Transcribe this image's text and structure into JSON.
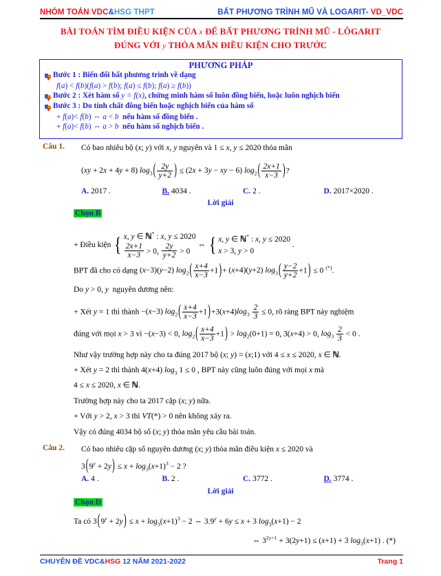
{
  "header": {
    "left_part1": "NHÓM TOÁN VDC",
    "left_amp": "&",
    "left_part2": "HSG THPT",
    "right_main": "BẤT PHƯƠNG TRÌNH MŨ VÀ LOGARIT-",
    "right_tag": "VD_VDC"
  },
  "title": {
    "line1_a": "BÀI TOÁN TÌM ĐIỀU KIỆN CỦA",
    "line1_var": "x",
    "line1_b": "ĐỂ BẤT PHƯƠNG TRÌNH  MŨ - LÔGARIT",
    "line2_a": "ĐÚNG VỚI",
    "line2_var": "y",
    "line2_b": "THỎA MÃN ĐIỀU KIỆN CHO TRƯỚC"
  },
  "method": {
    "heading": "PHƯƠNG PHÁP",
    "step1_label": "Bước  1 : Biến đổi bất phương trình về dạng",
    "step1_formula": "f(a) < f(b)(f(a) > f(b); f(a) ≤ f(b); f(a) ≥ f(b))",
    "step2_label_a": "Bước 2 : Xét hàm số",
    "step2_fn": "y = f(x)",
    "step2_label_b": ", chứng minh hàm số luôn đồng biến, hoặc luôn nghịch biến",
    "step3_label": "Bước 3 :  Do tính chất đồng biến hoặc nghịch biến của hàm số",
    "step3_sub1": "+ f(a) < f(b) ⇔ a < b nếu hàm số đồng biến .",
    "step3_sub2": "+ f(a) < f(b) ⇔ a > b nếu hàm số nghịch  biến ."
  },
  "q1": {
    "label": "Câu 1.",
    "prompt_a": "Có bao nhiêu bộ",
    "prompt_pair": "(x; y)",
    "prompt_b": "với",
    "prompt_vars": "x, y",
    "prompt_c": "nguyên và",
    "prompt_range": "1 ≤ x, y ≤ 2020",
    "prompt_d": "thỏa mãn",
    "equation": "(xy + 2x + 4y + 8) log₃(2y/(y+2)) ≤ (2x + 3y − xy − 6) log₂((2x+1)/(x−3)) ?",
    "answers": [
      {
        "key": "A.",
        "value": "2017 .",
        "selected": false
      },
      {
        "key": "B.",
        "value": "4034 .",
        "selected": true
      },
      {
        "key": "C.",
        "value": "2 .",
        "selected": false
      },
      {
        "key": "D.",
        "value": "2017×2020 .",
        "selected": false
      }
    ],
    "loigiai": "Lời giải",
    "chon": "Chọn B",
    "cond_label": "+ Điều kiện",
    "cond_left_row1": "x, y ∈ ℕ* : x, y ≤ 2020",
    "cond_left_row2": "(2x+1)/(x−3) > 0, 2y/(y+2) > 0",
    "cond_arrow": "⇔",
    "cond_right_row1": "x, y ∈ ℕ* : x, y ≤ 2020",
    "cond_right_row2": "x > 3, y > 0",
    "bpt_line_a": "BPT đã cho có dạng",
    "bpt_line_eq": "(x−3)(y−2) log₂((x+4)/(x−3) + 1) + (x+4)(y+2) log₃((y−2)/(y+2) + 1) ≤ 0",
    "bpt_star": "(*)",
    "do_line": "Do  y > 0 ,  y  nguyên dương nên:",
    "case1_a": "+ Xét  y = 1  thì  thành",
    "case1_eq": "−(x−3) log₂((x+4)/(x−3) + 1) + 3(x+4) log₃ (2/3) ≤ 0",
    "case1_b": ", rõ ràng BPT này nghiệm",
    "case1_c": "đúng với mọi  x > 3  vì  −(x−3) < 0,   log₂((x+4)/(x−3) + 1) > log₂(0+1) = 0,  3(x+4) > 0,  log₃(2/3) < 0 .",
    "case1_concl": "Như vậy trường hợp này cho ta đúng 2017 bộ (x; y) = (x;1)  với  4 ≤ x ≤ 2020, x ∈ ℕ .",
    "case2_a": "+ Xét  y = 2  thì  thành  4(x+4) log₃ 1 ≤ 0 , BPT này cũng luôn đúng với mọi x mà",
    "case2_b": "4 ≤ x ≤ 2020, x ∈ ℕ .",
    "case2_concl": "Trường hợp này cho ta 2017 cặp (x; y) nữa.",
    "case3": "+ Với  y > 2, x > 3  thì  VT(*) > 0  nên  không xảy ra.",
    "final": "Vậy có đúng 4034 bộ số (x; y) thỏa mãn yêu cầu bài toán."
  },
  "q2": {
    "label": "Câu 2.",
    "prompt_a": "Có bao nhiêu cặp số nguyên dương",
    "prompt_pair": "(x; y)",
    "prompt_b": "thỏa mãn điều kiện",
    "prompt_cond": "x ≤ 2020",
    "prompt_c": "và",
    "equation": "3(9ʸ + 2y) ≤ x + log₃(x+1)³ − 2 ?",
    "answers": [
      {
        "key": "A.",
        "value": "4 .",
        "selected": false
      },
      {
        "key": "B.",
        "value": "2 .",
        "selected": false
      },
      {
        "key": "C.",
        "value": "3772 .",
        "selected": false
      },
      {
        "key": "D.",
        "value": "3774 .",
        "selected": true
      }
    ],
    "loigiai": "Lời giải",
    "chon": "Chọn D",
    "sol_line1": "Ta có 3(9ʸ + 2y) ≤ x + log₃(x+1)³ − 2 ⇔ 3.9ʸ + 6y ≤ x + 3 log₃(x+1) − 2",
    "sol_line2": "⇔ 3^(2y+1) + 3(2y+1) ≤ (x+1) + 3 log₃(x+1) . (*)"
  },
  "footer": {
    "left_part1": "CHUYÊN ĐỀ VDC&",
    "left_hsg": "HSG",
    "left_part2": " 12 NĂM 2021-2022",
    "right": "Trang 1"
  },
  "colors": {
    "red": "#e8151a",
    "blue": "#1f4fd8",
    "light_blue": "#3a9ae0",
    "box_blue": "#1f1fcf",
    "brown": "#8a4b10",
    "highlight_green": "#00d400"
  }
}
